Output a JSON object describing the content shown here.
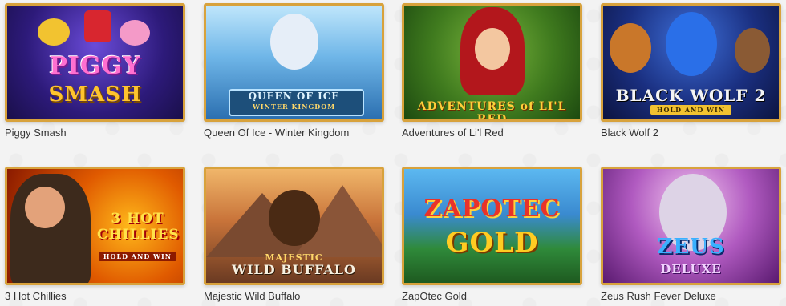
{
  "games": [
    {
      "title": "Piggy Smash",
      "logo_line1": "PIGGY",
      "logo_line2": "SMASH"
    },
    {
      "title": "Queen Of Ice - Winter Kingdom",
      "logo_line1": "QUEEN OF ICE",
      "logo_line2": "WINTER KINGDOM"
    },
    {
      "title": "Adventures of Li'l Red",
      "logo_line1": "ADVENTURES of LI'L RED",
      "logo_line2": ""
    },
    {
      "title": "Black Wolf 2",
      "logo_line1": "BLACK WOLF 2",
      "logo_line2": "HOLD AND WIN"
    },
    {
      "title": "3 Hot Chillies",
      "logo_line1": "3 HOT CHILLIES",
      "logo_line2": "HOLD AND WIN"
    },
    {
      "title": "Majestic Wild Buffalo",
      "logo_line1": "MAJESTIC",
      "logo_line2": "WILD BUFFALO"
    },
    {
      "title": "ZapOtec Gold",
      "logo_line1": "ZAPOTEC",
      "logo_line2": "GOLD"
    },
    {
      "title": "Zeus Rush Fever Deluxe",
      "logo_line1": "ZEUS",
      "logo_line2": "DELUXE"
    }
  ],
  "colors": {
    "frame": "#d8a23c",
    "caption_text": "#333333",
    "page_bg": "#f3f3f3"
  }
}
